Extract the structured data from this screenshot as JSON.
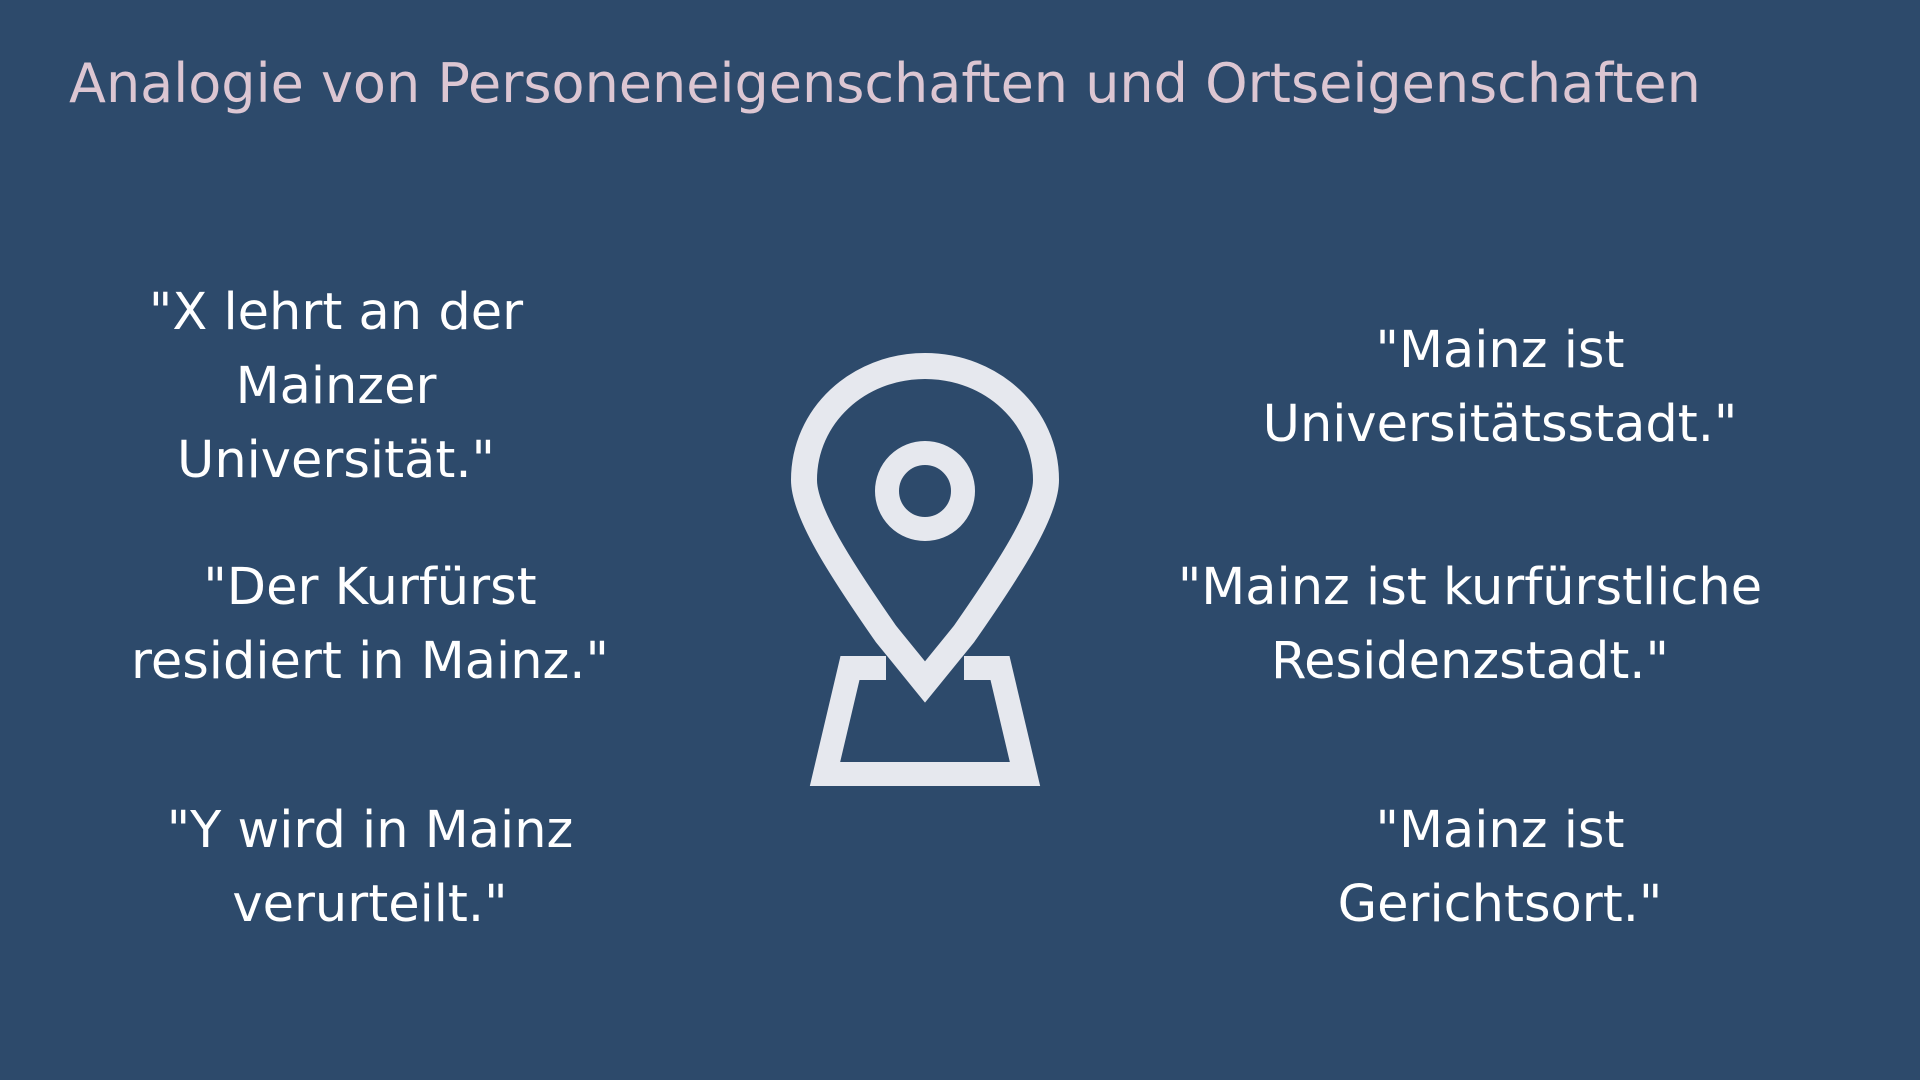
{
  "title": "Analogie von Personeneigenschaften und Ortseigenschaften",
  "person_properties": [
    {
      "lines": [
        "\"X lehrt an der",
        "Mainzer",
        "Universität.\""
      ]
    },
    {
      "lines": [
        "\"Der Kurfürst",
        "residiert in Mainz.\""
      ]
    },
    {
      "lines": [
        "\"Y wird in Mainz",
        "verurteilt.\""
      ]
    }
  ],
  "place_properties": [
    {
      "lines": [
        "\"Mainz ist",
        "Universitätsstadt.\""
      ]
    },
    {
      "lines": [
        "\"Mainz ist kurfürstliche",
        "Residenzstadt.\""
      ]
    },
    {
      "lines": [
        "\"Mainz ist",
        "Gerichtsort.\""
      ]
    }
  ],
  "icon": "map-pin-icon",
  "colors": {
    "background": "#2d4a6b",
    "title": "#dcc6d2",
    "text": "#ffffff",
    "icon": "#e6e8ee"
  }
}
